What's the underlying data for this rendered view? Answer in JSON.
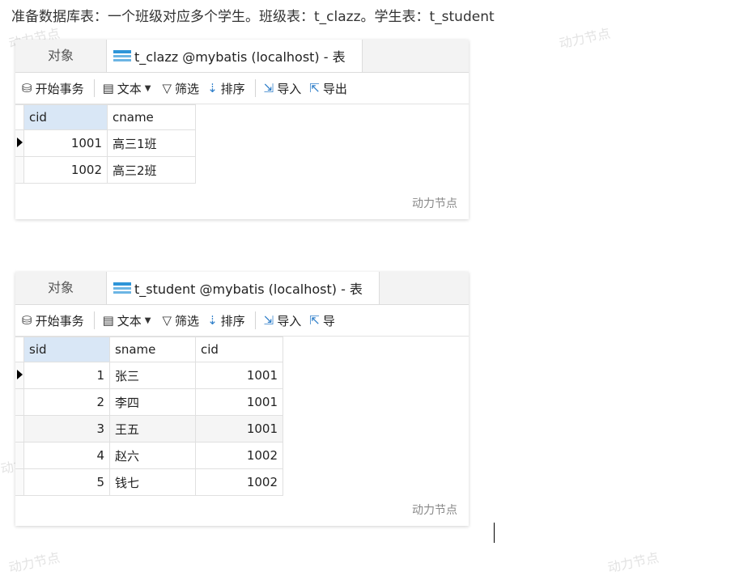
{
  "intro_text": "准备数据库表：一个班级对应多个学生。班级表：t_clazz。学生表：t_student",
  "watermarks": [
    "动力节点",
    "动力节点",
    "动力节点",
    "动力节点",
    "动力节点"
  ],
  "colors": {
    "table_icon": "#2e95d8",
    "selected_header": "#d9e7f6"
  },
  "clazz_window": {
    "tab_objects": "对象",
    "tab_title": "t_clazz @mybatis (localhost) - 表",
    "toolbar": {
      "begin_tx": "开始事务",
      "text": "文本",
      "filter": "筛选",
      "sort": "排序",
      "import": "导入",
      "export": "导出"
    },
    "columns": [
      "cid",
      "cname"
    ],
    "rows": [
      [
        "1001",
        "高三1班"
      ],
      [
        "1002",
        "高三2班"
      ]
    ],
    "watermark": "动力节点"
  },
  "student_window": {
    "tab_objects": "对象",
    "tab_title": "t_student @mybatis (localhost) - 表",
    "toolbar": {
      "begin_tx": "开始事务",
      "text": "文本",
      "filter": "筛选",
      "sort": "排序",
      "import": "导入",
      "export": "导"
    },
    "columns": [
      "sid",
      "sname",
      "cid"
    ],
    "rows": [
      [
        "1",
        "张三",
        "1001"
      ],
      [
        "2",
        "李四",
        "1001"
      ],
      [
        "3",
        "王五",
        "1001"
      ],
      [
        "4",
        "赵六",
        "1002"
      ],
      [
        "5",
        "钱七",
        "1002"
      ]
    ],
    "watermark": "动力节点"
  }
}
